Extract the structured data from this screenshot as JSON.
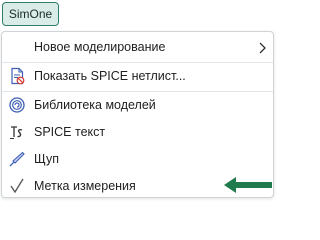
{
  "tab": {
    "label": "SimOne"
  },
  "menu": {
    "items": [
      {
        "label": "Новое моделирование",
        "icon": "none",
        "submenu": true
      },
      {
        "label": "Показать SPICE нетлист...",
        "icon": "netlist-document-icon"
      },
      {
        "label": "Библиотека моделей",
        "icon": "model-library-icon"
      },
      {
        "label": "SPICE текст",
        "icon": "spice-text-icon"
      },
      {
        "label": "Щуп",
        "icon": "probe-icon"
      },
      {
        "label": "Метка измерения",
        "icon": "checkmark-icon",
        "checked": true
      }
    ]
  },
  "colors": {
    "accent": "#2f7d6d",
    "tab_background": "#d9ece7",
    "icon_blue": "#3d5fb5",
    "pointer_arrow": "#1f7a4c"
  }
}
